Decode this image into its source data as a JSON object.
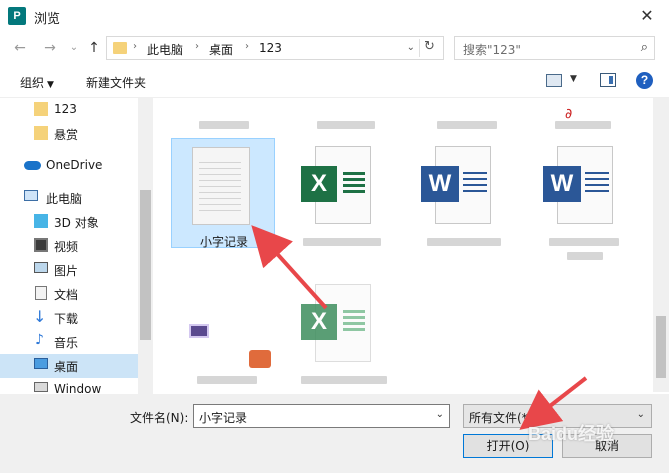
{
  "window": {
    "title": "浏览",
    "app_icon_letter": "P",
    "close_glyph": "✕"
  },
  "nav": {
    "back_glyph": "←",
    "forward_glyph": "→",
    "recent_glyph": "⌄",
    "up_glyph": "↑",
    "breadcrumb": [
      "此电脑",
      "桌面",
      "123"
    ],
    "refresh_glyph": "↻",
    "search_placeholder": "搜索\"123\"",
    "search_icon": "search-icon"
  },
  "toolbar": {
    "organize_label": "组织",
    "new_folder_label": "新建文件夹",
    "help_label": "?"
  },
  "sidebar": {
    "items": [
      {
        "label": "123",
        "icon": "folder-icon"
      },
      {
        "label": "悬赏",
        "icon": "folder-icon"
      },
      {
        "label": "OneDrive",
        "icon": "cloud-icon"
      },
      {
        "label": "此电脑",
        "icon": "computer-icon"
      },
      {
        "label": "3D 对象",
        "icon": "cube-icon"
      },
      {
        "label": "视频",
        "icon": "video-icon"
      },
      {
        "label": "图片",
        "icon": "pictures-icon"
      },
      {
        "label": "文档",
        "icon": "documents-icon"
      },
      {
        "label": "下载",
        "icon": "download-icon"
      },
      {
        "label": "音乐",
        "icon": "music-icon"
      },
      {
        "label": "桌面",
        "icon": "desktop-icon",
        "selected": true
      },
      {
        "label": "Window",
        "icon": "drive-icon"
      }
    ]
  },
  "files": {
    "selected_label": "小字记录",
    "excel_letter": "X",
    "word_letter": "W"
  },
  "bottom": {
    "filename_label": "文件名(N):",
    "filename_value": "小字记录",
    "filetype_value": "所有文件(*.*)",
    "open_label": "打开(O)",
    "cancel_label": "取消"
  },
  "colors": {
    "selection": "#cce8ff",
    "annotation_arrow": "#e8474a",
    "excel_green": "#1e7145",
    "word_blue": "#2b5797"
  },
  "watermark": "Baidu经验"
}
